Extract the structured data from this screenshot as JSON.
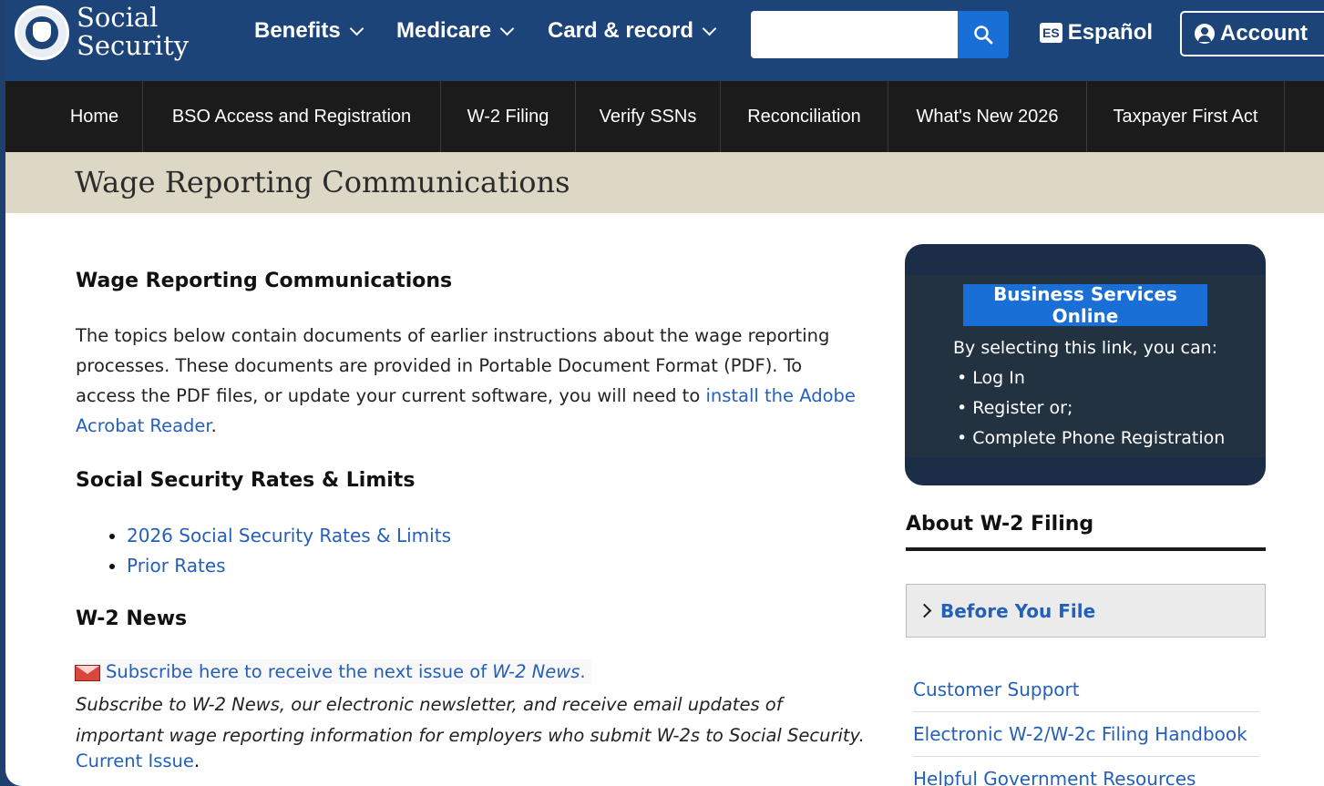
{
  "header": {
    "brand_line1": "Social",
    "brand_line2": "Security",
    "nav": [
      "Benefits",
      "Medicare",
      "Card & record"
    ],
    "search_placeholder": "",
    "espanol_badge": "ES",
    "espanol_label": "Español",
    "account_label": "Account"
  },
  "subnav": [
    "Home",
    "BSO Access and Registration",
    "W-2 Filing",
    "Verify SSNs",
    "Reconciliation",
    "What's New 2026",
    "Taxpayer First Act"
  ],
  "page_title": "Wage Reporting Communications",
  "main": {
    "heading": "Wage Reporting Communications",
    "intro_text": "The topics below contain documents of earlier instructions about the wage reporting processes. These documents are provided in Portable Document Format (PDF). To access the PDF files, or update your current software, you will need to ",
    "intro_link": "install the Adobe Acrobat Reader",
    "intro_end": ".",
    "rates_heading": "Social Security Rates & Limits",
    "rates_links": [
      "2026 Social Security Rates & Limits",
      "Prior Rates"
    ],
    "news_heading": "W-2 News",
    "subscribe_text": "Subscribe here to receive the next issue of ",
    "subscribe_em": "W-2 News",
    "subscribe_end": ".",
    "newsletter_text": "Subscribe to W-2 News, our electronic newsletter, and receive email updates of important wage reporting information for employers who submit W-2s to Social Security.",
    "current_issue": "Current Issue",
    "current_end": "."
  },
  "sidebar": {
    "bso_button": "Business Services Online",
    "bso_intro": "By selecting this link, you can:",
    "bso_items": [
      "Log In",
      "Register or;",
      "Complete Phone Registration"
    ],
    "about_title": "About W-2 Filing",
    "accordion_label": "Before You File",
    "links": [
      "Customer Support",
      "Electronic W-2/W-2c Filing Handbook",
      "Helpful Government Resources"
    ]
  }
}
